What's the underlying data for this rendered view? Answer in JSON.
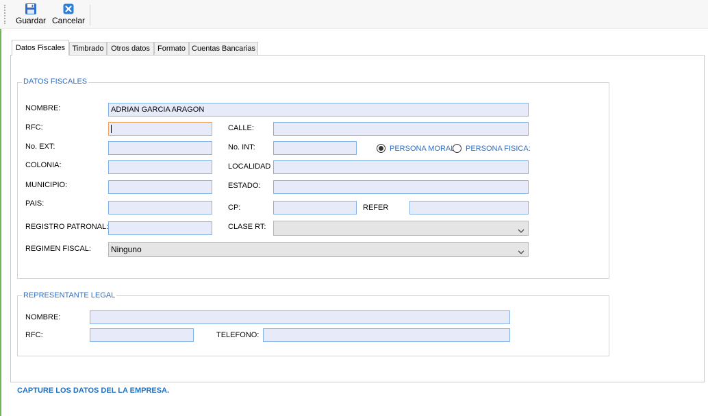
{
  "toolbar": {
    "save_label": "Guardar",
    "cancel_label": "Cancelar"
  },
  "tabs": [
    {
      "label": "Datos Fiscales",
      "active": true
    },
    {
      "label": "Timbrado"
    },
    {
      "label": "Otros datos"
    },
    {
      "label": "Formato"
    },
    {
      "label": "Cuentas Bancarias"
    }
  ],
  "datos_fiscales": {
    "legend": "DATOS FISCALES",
    "nombre": {
      "label": "NOMBRE:",
      "value": "ADRIAN GARCIA ARAGON"
    },
    "rfc": {
      "label": "RFC:",
      "value": ""
    },
    "calle": {
      "label": "CALLE:",
      "value": ""
    },
    "no_ext": {
      "label": "No. EXT:",
      "value": ""
    },
    "no_int": {
      "label": "No. INT:",
      "value": ""
    },
    "persona_moral": {
      "label": "PERSONA MORAL",
      "selected": true
    },
    "persona_fisica": {
      "label": "PERSONA FISICA:",
      "selected": false
    },
    "colonia": {
      "label": "COLONIA:",
      "value": ""
    },
    "localidad": {
      "label": "LOCALIDAD",
      "value": ""
    },
    "municipio": {
      "label": "MUNICIPIO:",
      "value": ""
    },
    "estado": {
      "label": "ESTADO:",
      "value": ""
    },
    "pais": {
      "label": "PAIS:",
      "value": ""
    },
    "cp": {
      "label": "CP:",
      "value": ""
    },
    "refer": {
      "label": "REFER",
      "value": ""
    },
    "registro_patronal": {
      "label": "REGISTRO PATRONAL:",
      "value": ""
    },
    "clase_rt": {
      "label": "CLASE RT:",
      "value": ""
    },
    "regimen_fiscal": {
      "label": "REGIMEN FISCAL:",
      "value": "Ninguno"
    }
  },
  "representante": {
    "legend": "REPRESENTANTE LEGAL",
    "nombre": {
      "label": "NOMBRE:",
      "value": ""
    },
    "rfc": {
      "label": "RFC:",
      "value": ""
    },
    "telefono": {
      "label": "TELEFONO:",
      "value": ""
    }
  },
  "status_text": "CAPTURE LOS DATOS DEL LA EMPRESA.",
  "colors": {
    "accent": "#2a6fc9",
    "field_bg": "#e6eaf9",
    "field_border": "#82b3e6",
    "focus_border": "#f2a25a",
    "status": "#1f6fbf"
  },
  "icons": {
    "save": "floppy-disk-icon",
    "cancel": "close-icon",
    "dropdown": "chevron-down-icon"
  }
}
